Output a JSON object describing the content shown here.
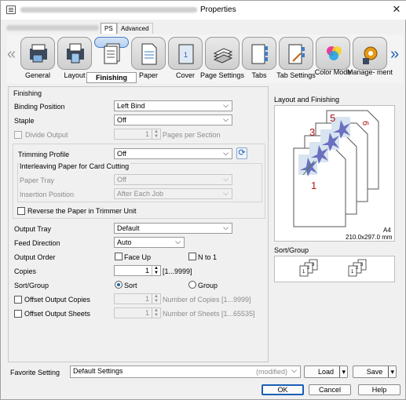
{
  "window": {
    "title": "Properties"
  },
  "tabs": [
    {
      "label": "PS"
    },
    {
      "label": "Advanced"
    }
  ],
  "categories": [
    {
      "label": "General"
    },
    {
      "label": "Layout"
    },
    {
      "label": "Finishing"
    },
    {
      "label": "Paper"
    },
    {
      "label": "Cover"
    },
    {
      "label": "Page Settings"
    },
    {
      "label": "Tabs"
    },
    {
      "label": "Tab Settings"
    },
    {
      "label": "Color Mode"
    },
    {
      "label": "Manage- ment"
    }
  ],
  "finishing": {
    "section": "Finishing",
    "binding_position": {
      "label": "Binding Position",
      "value": "Left Bind"
    },
    "staple": {
      "label": "Staple",
      "value": "Off"
    },
    "divide_output": {
      "label": "Divide Output",
      "value": "1",
      "unit": "Pages per Section"
    },
    "trimming_profile": {
      "label": "Trimming Profile",
      "value": "Off"
    },
    "interleaving": {
      "label": "Interleaving Paper for Card Cutting"
    },
    "paper_tray": {
      "label": "Paper Tray",
      "value": "Off"
    },
    "insertion_position": {
      "label": "Insertion Position",
      "value": "After Each Job"
    },
    "reverse_paper": {
      "label": "Reverse the Paper in Trimmer Unit"
    },
    "output_tray": {
      "label": "Output Tray",
      "value": "Default"
    },
    "feed_direction": {
      "label": "Feed Direction",
      "value": "Auto"
    },
    "output_order": {
      "label": "Output Order",
      "face_up": "Face Up",
      "n_to_1": "N to 1"
    },
    "copies": {
      "label": "Copies",
      "value": "1",
      "range": "[1...9999]"
    },
    "sort_group": {
      "label": "Sort/Group",
      "sort": "Sort",
      "group": "Group",
      "selected": "Sort"
    },
    "offset_copies": {
      "label": "Offset Output Copies",
      "value": "1",
      "unit": "Number of Copies [1...9999]"
    },
    "offset_sheets": {
      "label": "Offset Output Sheets",
      "value": "1",
      "unit": "Number of Sheets [1...65535]"
    }
  },
  "right_panel": {
    "layout_title": "Layout and Finishing",
    "paper_size": "A4",
    "paper_dims": "210.0x297.0 mm",
    "page_numbers": [
      "1",
      "3",
      "5",
      "6"
    ],
    "sort_title": "Sort/Group"
  },
  "favorite": {
    "label": "Favorite Setting",
    "value": "Default Settings",
    "status": "(modified)",
    "load": "Load",
    "save": "Save"
  },
  "footer": {
    "ok": "OK",
    "cancel": "Cancel",
    "help": "Help"
  },
  "colors": {
    "accent": "#1a5fb4",
    "selected_border": "#4a7cc1",
    "page_number": "#b01818"
  }
}
